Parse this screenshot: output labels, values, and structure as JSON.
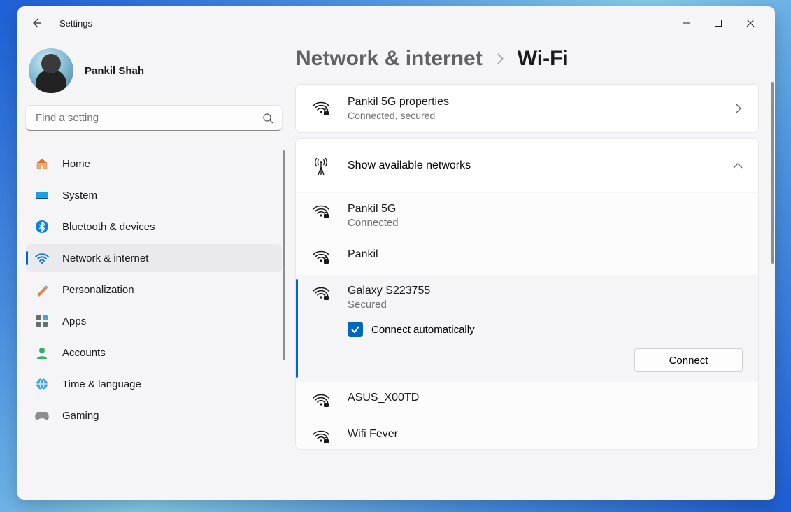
{
  "app_title": "Settings",
  "user_name": "Pankil Shah",
  "search_placeholder": "Find a setting",
  "sidebar": {
    "items": [
      {
        "id": "home",
        "label": "Home"
      },
      {
        "id": "system",
        "label": "System"
      },
      {
        "id": "bluetooth",
        "label": "Bluetooth & devices"
      },
      {
        "id": "network",
        "label": "Network & internet"
      },
      {
        "id": "personalization",
        "label": "Personalization"
      },
      {
        "id": "apps",
        "label": "Apps"
      },
      {
        "id": "accounts",
        "label": "Accounts"
      },
      {
        "id": "time",
        "label": "Time & language"
      },
      {
        "id": "gaming",
        "label": "Gaming"
      }
    ],
    "selected_index": 3
  },
  "breadcrumb": {
    "parent": "Network & internet",
    "current": "Wi-Fi"
  },
  "properties_card": {
    "title": "Pankil 5G properties",
    "subtitle": "Connected, secured"
  },
  "available_panel": {
    "title": "Show available networks",
    "expanded": true
  },
  "networks": [
    {
      "ssid": "Pankil 5G",
      "status": "Connected",
      "secured": true
    },
    {
      "ssid": "Pankil",
      "status": "",
      "secured": true
    },
    {
      "ssid": "Galaxy S223755",
      "status": "Secured",
      "secured": true,
      "selected": true,
      "auto_connect_label": "Connect automatically",
      "auto_connect_checked": true,
      "connect_label": "Connect"
    },
    {
      "ssid": "ASUS_X00TD",
      "status": "",
      "secured": true
    },
    {
      "ssid": "Wifi Fever",
      "status": "",
      "secured": true
    }
  ]
}
